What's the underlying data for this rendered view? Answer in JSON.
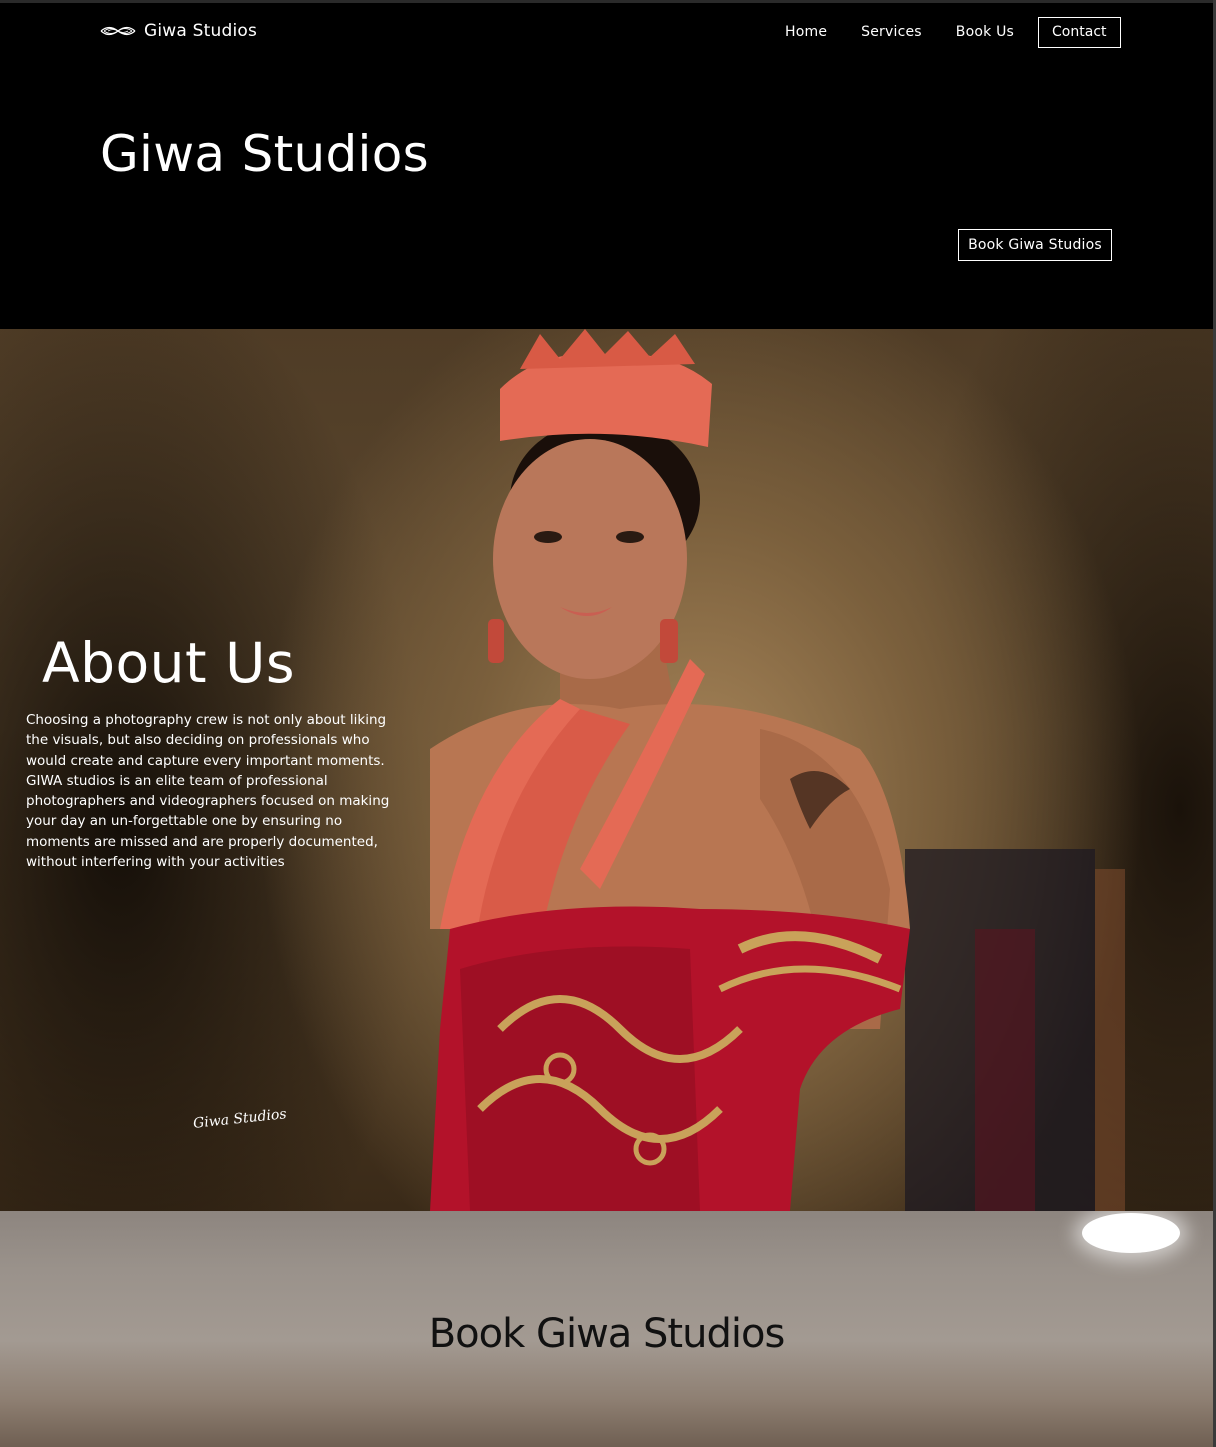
{
  "brand": {
    "name": "Giwa Studios",
    "logo_icon": "wave-logo-icon"
  },
  "nav": {
    "items": [
      "Home",
      "Services",
      "Book Us"
    ],
    "contact_label": "Contact"
  },
  "hero": {
    "title": "Giwa Studios",
    "cta_label": "Book Giwa Studios"
  },
  "about": {
    "title": "About Us",
    "body": "Choosing a photography crew is not only about liking the visuals, but also deciding on professionals who would create and capture every important moments. GIWA studios is an elite team of professional photographers and videographers focused on making your day an un-forgettable one by ensuring no moments are missed and are properly documented, without interfering with your activities",
    "signature": "Giwa Studios"
  },
  "booking": {
    "title": "Book Giwa Studios"
  },
  "colors": {
    "header_bg": "#000000",
    "text": "#ffffff",
    "booking_title": "#111111",
    "coral": "#e46a55",
    "dress_red": "#b3122a",
    "gold": "#c9a25a"
  }
}
